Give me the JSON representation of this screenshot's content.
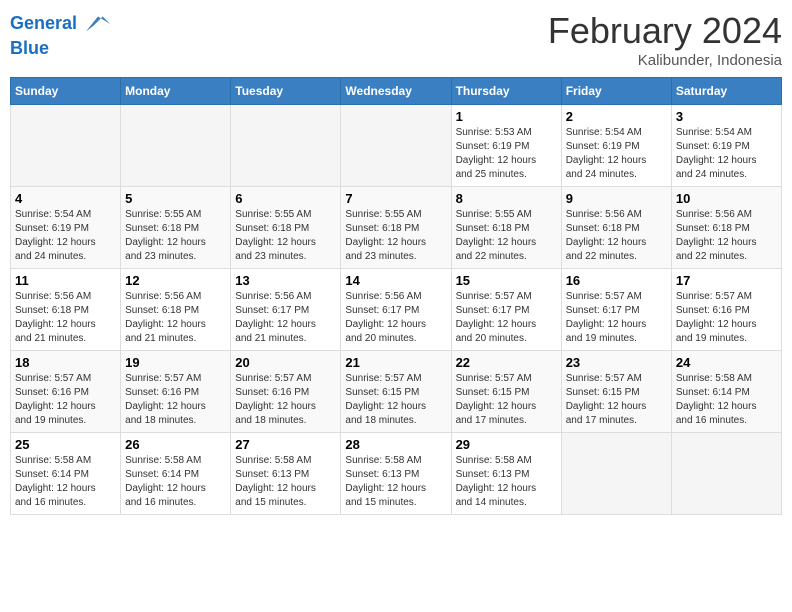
{
  "header": {
    "logo_line1": "General",
    "logo_line2": "Blue",
    "month": "February 2024",
    "location": "Kalibunder, Indonesia"
  },
  "weekdays": [
    "Sunday",
    "Monday",
    "Tuesday",
    "Wednesday",
    "Thursday",
    "Friday",
    "Saturday"
  ],
  "weeks": [
    [
      {
        "day": "",
        "info": ""
      },
      {
        "day": "",
        "info": ""
      },
      {
        "day": "",
        "info": ""
      },
      {
        "day": "",
        "info": ""
      },
      {
        "day": "1",
        "info": "Sunrise: 5:53 AM\nSunset: 6:19 PM\nDaylight: 12 hours\nand 25 minutes."
      },
      {
        "day": "2",
        "info": "Sunrise: 5:54 AM\nSunset: 6:19 PM\nDaylight: 12 hours\nand 24 minutes."
      },
      {
        "day": "3",
        "info": "Sunrise: 5:54 AM\nSunset: 6:19 PM\nDaylight: 12 hours\nand 24 minutes."
      }
    ],
    [
      {
        "day": "4",
        "info": "Sunrise: 5:54 AM\nSunset: 6:19 PM\nDaylight: 12 hours\nand 24 minutes."
      },
      {
        "day": "5",
        "info": "Sunrise: 5:55 AM\nSunset: 6:18 PM\nDaylight: 12 hours\nand 23 minutes."
      },
      {
        "day": "6",
        "info": "Sunrise: 5:55 AM\nSunset: 6:18 PM\nDaylight: 12 hours\nand 23 minutes."
      },
      {
        "day": "7",
        "info": "Sunrise: 5:55 AM\nSunset: 6:18 PM\nDaylight: 12 hours\nand 23 minutes."
      },
      {
        "day": "8",
        "info": "Sunrise: 5:55 AM\nSunset: 6:18 PM\nDaylight: 12 hours\nand 22 minutes."
      },
      {
        "day": "9",
        "info": "Sunrise: 5:56 AM\nSunset: 6:18 PM\nDaylight: 12 hours\nand 22 minutes."
      },
      {
        "day": "10",
        "info": "Sunrise: 5:56 AM\nSunset: 6:18 PM\nDaylight: 12 hours\nand 22 minutes."
      }
    ],
    [
      {
        "day": "11",
        "info": "Sunrise: 5:56 AM\nSunset: 6:18 PM\nDaylight: 12 hours\nand 21 minutes."
      },
      {
        "day": "12",
        "info": "Sunrise: 5:56 AM\nSunset: 6:18 PM\nDaylight: 12 hours\nand 21 minutes."
      },
      {
        "day": "13",
        "info": "Sunrise: 5:56 AM\nSunset: 6:17 PM\nDaylight: 12 hours\nand 21 minutes."
      },
      {
        "day": "14",
        "info": "Sunrise: 5:56 AM\nSunset: 6:17 PM\nDaylight: 12 hours\nand 20 minutes."
      },
      {
        "day": "15",
        "info": "Sunrise: 5:57 AM\nSunset: 6:17 PM\nDaylight: 12 hours\nand 20 minutes."
      },
      {
        "day": "16",
        "info": "Sunrise: 5:57 AM\nSunset: 6:17 PM\nDaylight: 12 hours\nand 19 minutes."
      },
      {
        "day": "17",
        "info": "Sunrise: 5:57 AM\nSunset: 6:16 PM\nDaylight: 12 hours\nand 19 minutes."
      }
    ],
    [
      {
        "day": "18",
        "info": "Sunrise: 5:57 AM\nSunset: 6:16 PM\nDaylight: 12 hours\nand 19 minutes."
      },
      {
        "day": "19",
        "info": "Sunrise: 5:57 AM\nSunset: 6:16 PM\nDaylight: 12 hours\nand 18 minutes."
      },
      {
        "day": "20",
        "info": "Sunrise: 5:57 AM\nSunset: 6:16 PM\nDaylight: 12 hours\nand 18 minutes."
      },
      {
        "day": "21",
        "info": "Sunrise: 5:57 AM\nSunset: 6:15 PM\nDaylight: 12 hours\nand 18 minutes."
      },
      {
        "day": "22",
        "info": "Sunrise: 5:57 AM\nSunset: 6:15 PM\nDaylight: 12 hours\nand 17 minutes."
      },
      {
        "day": "23",
        "info": "Sunrise: 5:57 AM\nSunset: 6:15 PM\nDaylight: 12 hours\nand 17 minutes."
      },
      {
        "day": "24",
        "info": "Sunrise: 5:58 AM\nSunset: 6:14 PM\nDaylight: 12 hours\nand 16 minutes."
      }
    ],
    [
      {
        "day": "25",
        "info": "Sunrise: 5:58 AM\nSunset: 6:14 PM\nDaylight: 12 hours\nand 16 minutes."
      },
      {
        "day": "26",
        "info": "Sunrise: 5:58 AM\nSunset: 6:14 PM\nDaylight: 12 hours\nand 16 minutes."
      },
      {
        "day": "27",
        "info": "Sunrise: 5:58 AM\nSunset: 6:13 PM\nDaylight: 12 hours\nand 15 minutes."
      },
      {
        "day": "28",
        "info": "Sunrise: 5:58 AM\nSunset: 6:13 PM\nDaylight: 12 hours\nand 15 minutes."
      },
      {
        "day": "29",
        "info": "Sunrise: 5:58 AM\nSunset: 6:13 PM\nDaylight: 12 hours\nand 14 minutes."
      },
      {
        "day": "",
        "info": ""
      },
      {
        "day": "",
        "info": ""
      }
    ]
  ]
}
